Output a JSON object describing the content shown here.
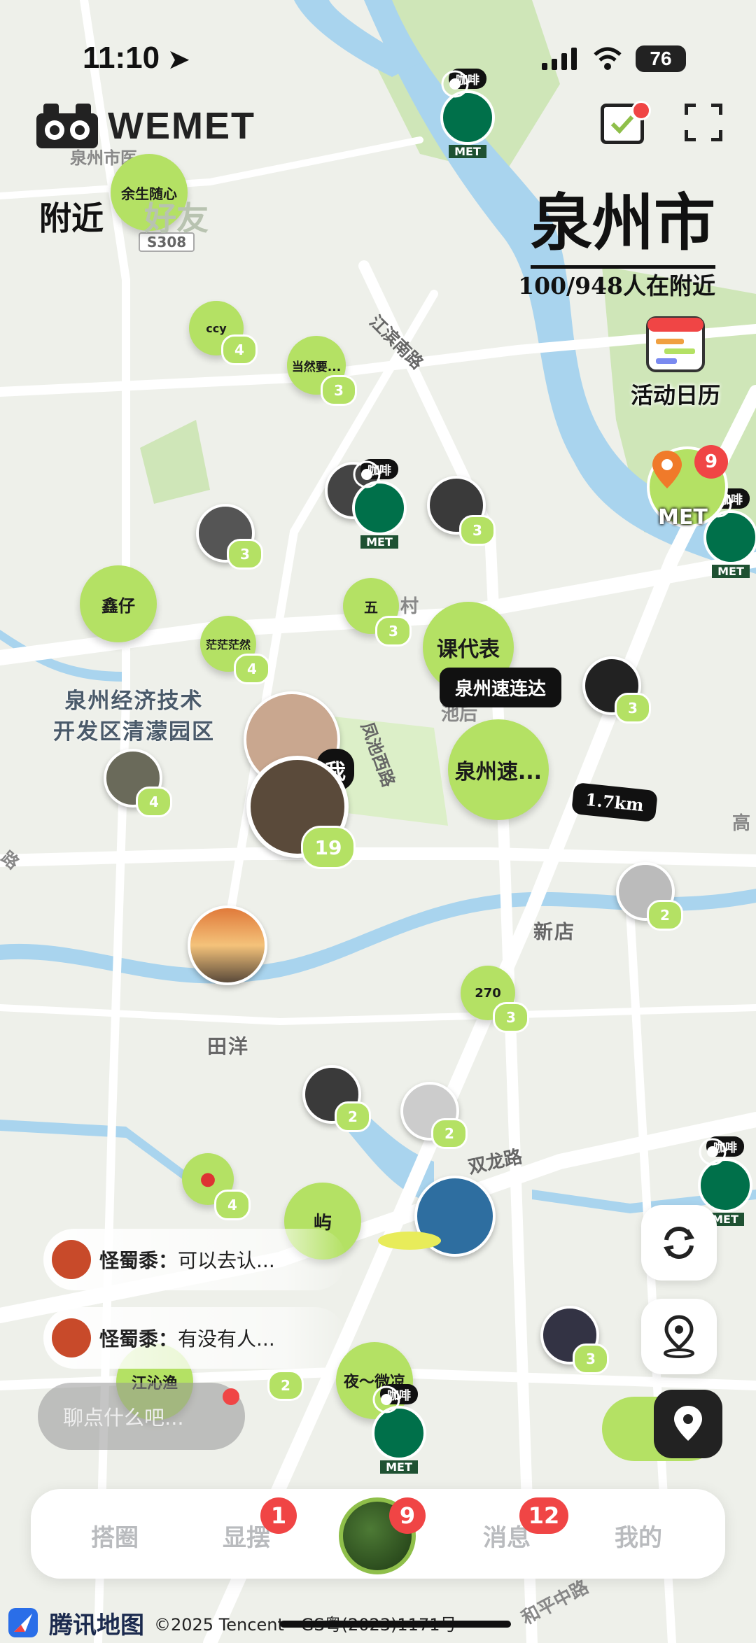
{
  "status": {
    "time": "11:10",
    "battery": "76"
  },
  "header": {
    "logo": "WEMET",
    "tab_nearby": "附近",
    "tab_friends": "好友",
    "city": "泉州市",
    "nearby_count": "100/948人在附近",
    "calendar_label": "活动日历"
  },
  "map_places": {
    "dev_zone_line1": "泉州经济技术",
    "dev_zone_line2": "开发区清濛园区",
    "xindian": "新店",
    "tianyang": "田洋",
    "shuanglong": "双龙路",
    "fengchi": "凤池西路",
    "jiangbin": "江滨南路",
    "s308": "S308",
    "quanzhou_hospital": "泉州市医",
    "cun": "村",
    "chihou": "池后",
    "gao": "高",
    "lu": "路",
    "heping": "和平中路",
    "yu": "屿"
  },
  "bubbles": [
    {
      "label": "余生随心"
    },
    {
      "label": "ccy",
      "count": "4"
    },
    {
      "label": "当然要...",
      "count": "3"
    },
    {
      "label": "鑫仔"
    },
    {
      "label": "茫茫茫然",
      "count": "4"
    },
    {
      "label": "五",
      "count": "3"
    },
    {
      "label": "课代表"
    },
    {
      "label": "泉州速...",
      "tag": "泉州速连达"
    },
    {
      "label": "270",
      "count": "3"
    },
    {
      "label": "江沁渔"
    },
    {
      "label": "夜～微凉"
    },
    {
      "label": "屿"
    }
  ],
  "avatars": {
    "a1_count": "3",
    "a2_count": "3",
    "a3_count": "3",
    "a4_count": "4",
    "a5_count": "3",
    "me_label": "我",
    "me_count": "19",
    "a6_count": "2",
    "a7_count": "2",
    "a8_count": "2",
    "a9_count": "3",
    "a10_count": "2",
    "fruit_count": "4"
  },
  "distance": "1.7km",
  "starbucks": {
    "tag": "咖啡",
    "met": "MET"
  },
  "met_pin": {
    "label": "MET",
    "badge": "9"
  },
  "chats": [
    {
      "name": "怪蜀黍：",
      "text": "可以去认..."
    },
    {
      "name": "怪蜀黍：",
      "text": "有没有人..."
    }
  ],
  "input_placeholder": "聊点什么吧...",
  "tabs": {
    "circle": "搭圈",
    "flash": "显摆",
    "flash_badge": "1",
    "center_badge": "9",
    "messages": "消息",
    "messages_badge": "12",
    "me": "我的"
  },
  "footer": {
    "brand": "腾讯地图",
    "copyright": "©2025 Tencent - GS粤(2023)1171号"
  },
  "colors": {
    "accent": "#b4e164",
    "badge": "#f04545",
    "water": "#a9d4ee",
    "park": "#cfe6b8"
  }
}
